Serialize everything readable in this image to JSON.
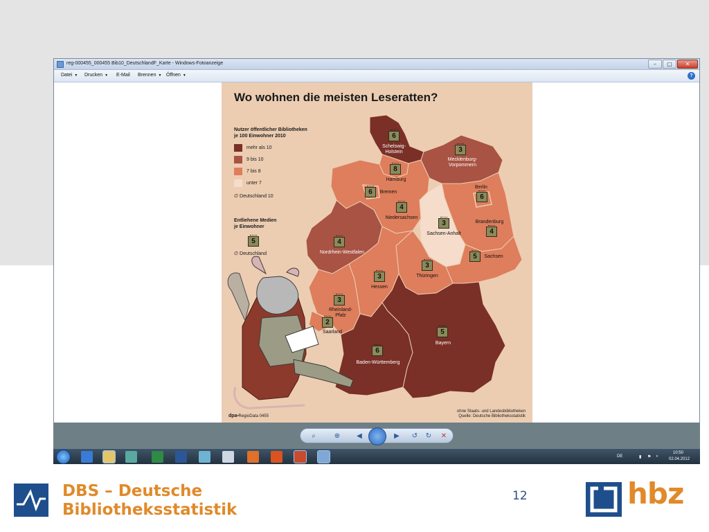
{
  "window": {
    "title": "reg-000455_000455 Bib10_DeutschlandF_Karte - Windows-Fotoanzeige",
    "controls": {
      "minimize": "–",
      "maximize": "□",
      "close": "✕"
    }
  },
  "menu": {
    "items": [
      "Datei",
      "Drucken",
      "E-Mail",
      "Brennen",
      "Öffnen"
    ],
    "help": "?"
  },
  "infographic": {
    "title": "Wo wohnen die meisten Leseratten?",
    "legend1_heading_line1": "Nutzer öffentlicher Bibliotheken",
    "legend1_heading_line2": "je 100 Einwohner 2010",
    "legend_items": [
      {
        "label": "mehr als 10",
        "color": "#7a2f27"
      },
      {
        "label": "9 bis 10",
        "color": "#a85343"
      },
      {
        "label": "7 bis 8",
        "color": "#de7e5c"
      },
      {
        "label": "unter 7",
        "color": "#f6dccb"
      }
    ],
    "avg1": "∅ Deutschland 10",
    "legend2_heading_line1": "Entliehene Medien",
    "legend2_heading_line2": "je Einwohner",
    "legend2_badge": "5",
    "avg2": "∅ Deutschland",
    "source_line1": "ohne Staats- und Landesbibliotheken",
    "source_line2": "Quelle: Deutsche Bibliotheksstatistik",
    "credit_brand": "dpa",
    "credit_rest": "•RegioData 0455"
  },
  "map": {
    "states": [
      {
        "label": "Schelswig-Holstein",
        "label_lines": [
          "Schelswig-",
          "Holstein"
        ],
        "media": "6",
        "category": "mehr als 10"
      },
      {
        "label": "Mecklenburg-Vorpommern",
        "label_lines": [
          "Mecklenburg-",
          "Vorpommern"
        ],
        "media": "3",
        "category": "9 bis 10"
      },
      {
        "label": "Hamburg",
        "label_lines": [
          "Hamburg"
        ],
        "media": "8",
        "category": "7 bis 8"
      },
      {
        "label": "Bremen",
        "label_lines": [
          "Bremen"
        ],
        "media": "6",
        "category": "7 bis 8"
      },
      {
        "label": "Berlin",
        "label_lines": [
          "Berlin"
        ],
        "media": "6",
        "category": "7 bis 8"
      },
      {
        "label": "Niedersachsen",
        "label_lines": [
          "Niedersachsen"
        ],
        "media": "4",
        "category": "7 bis 8"
      },
      {
        "label": "Brandenburg",
        "label_lines": [
          "Brandenburg"
        ],
        "media": "4",
        "category": "7 bis 8"
      },
      {
        "label": "Sachsen-Anhalt",
        "label_lines": [
          "Sachsen-Anhalt"
        ],
        "media": "3",
        "category": "unter 7"
      },
      {
        "label": "Nordrhein-Westfalen",
        "label_lines": [
          "Nordrhein-Westfalen"
        ],
        "media": "4",
        "category": "9 bis 10"
      },
      {
        "label": "Sachsen",
        "label_lines": [
          "Sachsen"
        ],
        "media": "5",
        "category": "7 bis 8"
      },
      {
        "label": "Thüringen",
        "label_lines": [
          "Thüringen"
        ],
        "media": "3",
        "category": "7 bis 8"
      },
      {
        "label": "Hessen",
        "label_lines": [
          "Hessen"
        ],
        "media": "3",
        "category": "7 bis 8"
      },
      {
        "label": "Rheinland-Pfalz",
        "label_lines": [
          "Rheinland-",
          "Pfalz"
        ],
        "media": "3",
        "category": "7 bis 8"
      },
      {
        "label": "Saarland",
        "label_lines": [
          "Saarland"
        ],
        "media": "2",
        "category": "7 bis 8"
      },
      {
        "label": "Bayern",
        "label_lines": [
          "Bayern"
        ],
        "media": "5",
        "category": "mehr als 10"
      },
      {
        "label": "Baden-Württemberg",
        "label_lines": [
          "Baden-Württemberg"
        ],
        "media": "6",
        "category": "mehr als 10"
      }
    ]
  },
  "viewer_controls": {
    "zoom": "⌕",
    "fit": "⊕",
    "previous": "◀",
    "next": "▶",
    "rotate_left": "↺",
    "rotate_right": "↻",
    "delete": "✕"
  },
  "taskbar": {
    "language": "DE",
    "time": "10:50",
    "date": "02.04.2012"
  },
  "footer": {
    "dbs_line1": "DBS – Deutsche",
    "dbs_line2": "Bibliotheksstatistik",
    "page_number": "12",
    "hbz_text": "hbz"
  },
  "colors": {
    "mehr_als_10": "#7a2f27",
    "bis_9_10": "#a85343",
    "bis_7_8": "#de7e5c",
    "unter_7": "#f6dccb",
    "badge": "#8b8a5a",
    "brand_orange": "#e08a2a",
    "brand_blue": "#1f4e8c"
  }
}
